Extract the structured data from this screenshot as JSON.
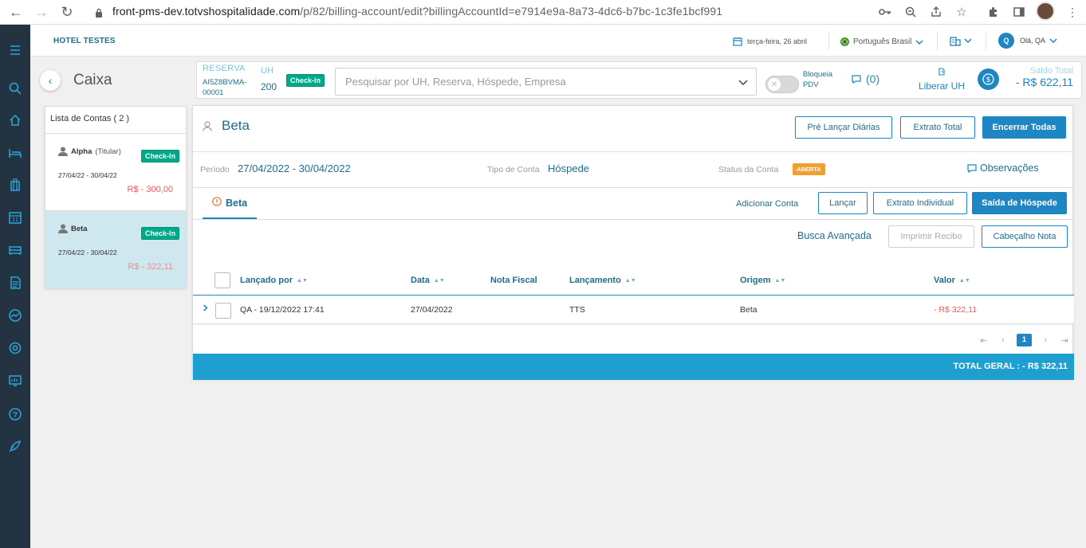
{
  "browser": {
    "url_host": "front-pms-dev.totvshospitalidade.com",
    "url_path": "/p/82/billing-account/edit?billingAccountId=e7914e9a-8a73-4dc6-b7bc-1c3fe1bcf991"
  },
  "header": {
    "hotel": "HOTEL TESTES",
    "date": "terça-feira, 26 abril",
    "language": "Português Brasil",
    "avatar_initial": "Q",
    "greeting": "Olá, QA"
  },
  "page": {
    "title": "Caixa"
  },
  "reservation": {
    "label": "RESERVA",
    "code": "AI5Z8BVMA-00001",
    "uh_label": "UH",
    "uh_value": "200",
    "status": "Check-In",
    "search_placeholder": "Pesquisar por UH, Reserva, Hóspede, Empresa",
    "block_pdv": "Bloqueia PDV",
    "messages_count": "(0)",
    "release_uh": "Liberar UH",
    "balance_label": "Saldo Total",
    "balance_value": "- R$ 622,11"
  },
  "accounts": {
    "header": "Lista de Contas ( 2 )",
    "items": [
      {
        "name": "Alpha",
        "role": "(Titular)",
        "status": "Check-In",
        "period": "27/04/22 - 30/04/22",
        "value": "R$ - 300,00"
      },
      {
        "name": "Beta",
        "role": "",
        "status": "Check-In",
        "period": "27/04/22 - 30/04/22",
        "value": "R$ - 322,11"
      }
    ]
  },
  "account": {
    "name": "Beta",
    "btn_pre_launch": "Pré Lançar Diárias",
    "btn_extract_total": "Extrato Total",
    "btn_close_all": "Encerrar Todas",
    "period_label": "Período",
    "period_value": "27/04/2022 - 30/04/2022",
    "type_label": "Tipo de Conta",
    "type_value": "Hóspede",
    "status_label": "Status da Conta",
    "status_value": "ABERTA",
    "observations": "Observações",
    "tab_label": "Beta",
    "btn_add_account": "Adicionar Conta",
    "btn_launch": "Lançar",
    "btn_extract_individual": "Extrato Individual",
    "btn_guest_checkout": "Saída de Hóspede",
    "advanced_search": "Busca Avançada",
    "btn_print_receipt": "Imprimir Recibo",
    "btn_note_header": "Cabeçalho Nota"
  },
  "table": {
    "columns": [
      "Lançado por",
      "Data",
      "Nota Fiscal",
      "Lançamento",
      "Origem",
      "Valor"
    ],
    "rows": [
      {
        "launched_by": "QA - 19/12/2022 17:41",
        "date": "27/04/2022",
        "invoice": "",
        "entry": "TTS",
        "origin": "Beta",
        "value": "- R$ 322,11"
      }
    ]
  },
  "pagination": {
    "current_page": "1"
  },
  "total": "TOTAL GERAL : - R$ 322,11",
  "colors": {
    "primary": "#1f86c4",
    "sidebar": "#243342",
    "success": "#00a98a",
    "warning": "#f0a030",
    "negative": "#e85a5a"
  }
}
